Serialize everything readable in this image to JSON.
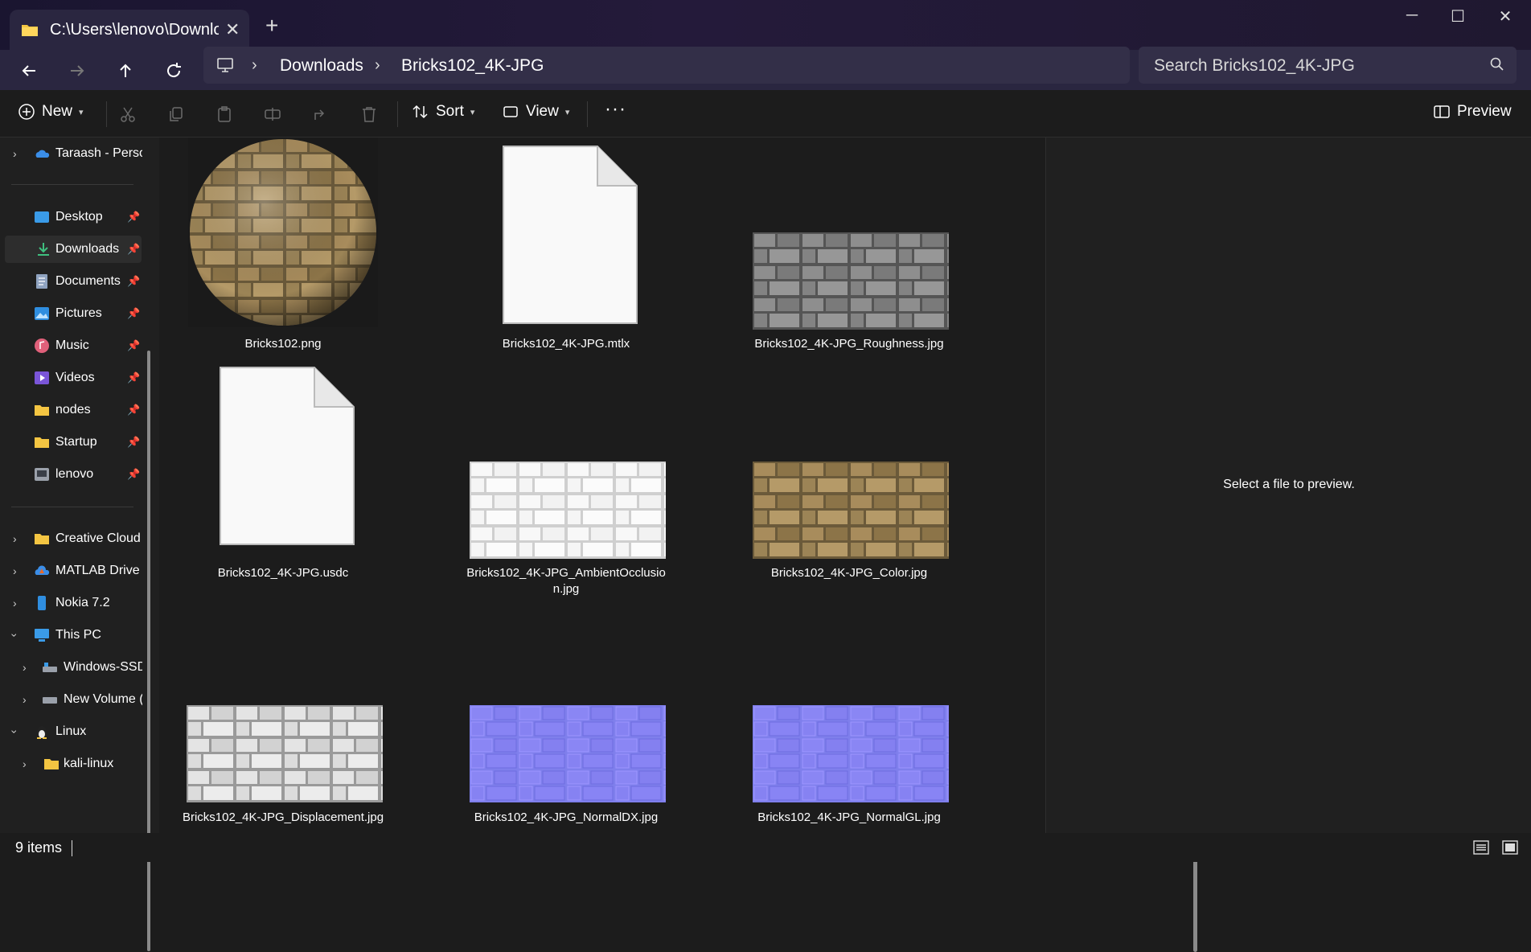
{
  "window": {
    "tab_title": "C:\\Users\\lenovo\\Downloads",
    "tab_close": "✕",
    "new_tab": "+",
    "minimize": "─",
    "maximize": "☐",
    "close": "✕"
  },
  "address": {
    "crumbs": [
      "Downloads",
      "Bricks102_4K-JPG"
    ],
    "separator": "›"
  },
  "search": {
    "placeholder": "Search Bricks102_4K-JPG"
  },
  "toolbar": {
    "new_label": "New",
    "sort_label": "Sort",
    "view_label": "View",
    "more_label": "···",
    "preview_label": "Preview"
  },
  "sidebar": {
    "items": [
      {
        "label": "Taraash - Personal",
        "icon": "onedrive-icon"
      },
      {
        "label": "Desktop",
        "icon": "desktop-icon"
      },
      {
        "label": "Downloads",
        "icon": "download-icon"
      },
      {
        "label": "Documents",
        "icon": "documents-icon"
      },
      {
        "label": "Pictures",
        "icon": "pictures-icon"
      },
      {
        "label": "Music",
        "icon": "music-icon"
      },
      {
        "label": "Videos",
        "icon": "videos-icon"
      },
      {
        "label": "nodes",
        "icon": "folder-icon"
      },
      {
        "label": "Startup",
        "icon": "folder-icon"
      },
      {
        "label": "lenovo",
        "icon": "user-folder-icon"
      },
      {
        "label": "Creative Cloud Files",
        "icon": "folder-icon"
      },
      {
        "label": "MATLAB Drive",
        "icon": "matlab-icon"
      },
      {
        "label": "Nokia 7.2",
        "icon": "phone-icon"
      },
      {
        "label": "This PC",
        "icon": "pc-icon"
      },
      {
        "label": "Windows-SSD",
        "icon": "drive-icon"
      },
      {
        "label": "New Volume (D:)",
        "icon": "drive-icon"
      },
      {
        "label": "Linux",
        "icon": "linux-icon"
      },
      {
        "label": "kali-linux",
        "icon": "folder-icon"
      }
    ]
  },
  "files": [
    {
      "name": "Bricks102.png"
    },
    {
      "name": "Bricks102_4K-JPG.mtlx"
    },
    {
      "name": "Bricks102_4K-JPG_Roughness.jpg"
    },
    {
      "name": "Bricks102_4K-JPG.usdc"
    },
    {
      "name": "Bricks102_4K-JPG_AmbientOcclusion.jpg"
    },
    {
      "name": "Bricks102_4K-JPG_Color.jpg"
    },
    {
      "name": "Bricks102_4K-JPG_Displacement.jpg"
    },
    {
      "name": "Bricks102_4K-JPG_NormalDX.jpg"
    },
    {
      "name": "Bricks102_4K-JPG_NormalGL.jpg"
    }
  ],
  "preview": {
    "message": "Select a file to preview."
  },
  "status": {
    "item_count": "9 items"
  },
  "colors": {
    "accent_folder": "#f4c542",
    "normal_map": "#8080f0",
    "background": "#1c1c1c"
  }
}
